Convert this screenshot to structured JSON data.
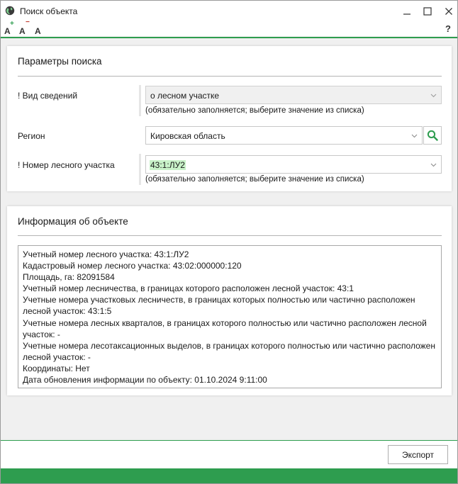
{
  "window": {
    "title": "Поиск объекта",
    "accent_color": "#2e9d4f",
    "icons": {
      "app": "globe-icon",
      "minimize": "minimize-icon",
      "maximize": "maximize-icon",
      "close": "close-icon"
    }
  },
  "toolbar": {
    "font_increase": "A",
    "font_increase_sign": "+",
    "font_decrease": "A",
    "font_decrease_sign": "−",
    "font_default": "A",
    "help": "?"
  },
  "search_params": {
    "title": "Параметры поиска",
    "info_type": {
      "label": "! Вид сведений",
      "value": "о лесном участке",
      "hint": "(обязательно заполняется; выберите значение из списка)"
    },
    "region": {
      "label": "Регион",
      "value": "Кировская область",
      "search_icon": "search-icon"
    },
    "plot_number": {
      "label": "! Номер лесного участка",
      "value": "43:1:ЛУ2",
      "highlight_color": "#c9f2c9",
      "hint": "(обязательно заполняется; выберите значение из списка)"
    }
  },
  "object_info": {
    "title": "Информация об объекте",
    "lines": [
      "Учетный номер лесного участка: 43:1:ЛУ2",
      "Кадастровый номер лесного участка: 43:02:000000:120",
      "Площадь, га: 82091584",
      "Учетный номер лесничества, в границах которого расположен лесной участок: 43:1",
      "Учетные номера участковых лесничеств, в границах которых полностью или частично расположен",
      "лесной участок: 43:1:5",
      "Учетные номера лесных кварталов, в границах которого полностью или частично расположен лесной",
      "участок: -",
      "Учетные номера лесотаксационных выделов, в границах которого полностью или частично расположен",
      "лесной участок: -",
      "Координаты: Нет",
      "Дата обновления информации по объекту: 01.10.2024 9:11:00"
    ]
  },
  "footer": {
    "export_label": "Экспорт"
  }
}
